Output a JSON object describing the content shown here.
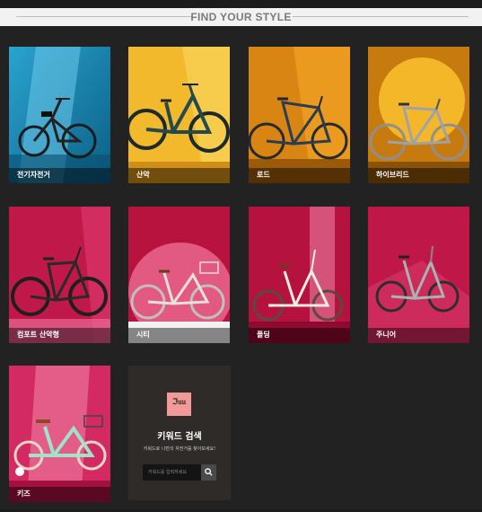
{
  "section": {
    "title": "FIND YOUR STYLE"
  },
  "categories": [
    {
      "label": "전기자전거",
      "icon": "folding-ebike-image"
    },
    {
      "label": "산악",
      "icon": "mountain-bike-image"
    },
    {
      "label": "로드",
      "icon": "road-bike-image"
    },
    {
      "label": "하이브리드",
      "icon": "hybrid-bike-image"
    },
    {
      "label": "컴포트 산악형",
      "icon": "comfort-mtb-image"
    },
    {
      "label": "시티",
      "icon": "city-bike-image"
    },
    {
      "label": "폴딩",
      "icon": "folding-bike-image"
    },
    {
      "label": "주니어",
      "icon": "junior-bike-image"
    },
    {
      "label": "키즈",
      "icon": "kids-bike-image"
    }
  ],
  "keyword_search": {
    "logo_text": "ℑ𝔲𝔲",
    "title": "키워드 검색",
    "description": "키워드로 나만의 자전거를 찾아보세요!",
    "placeholder": "키워드를 입력하세요",
    "button_icon": "search-icon"
  },
  "colors": {
    "page_bg": "#222222",
    "header_bg": "#f2f2f2",
    "header_text": "#7a7a7a",
    "keyword_panel": "#2e2b29",
    "logo_pink": "#f29a9a"
  }
}
